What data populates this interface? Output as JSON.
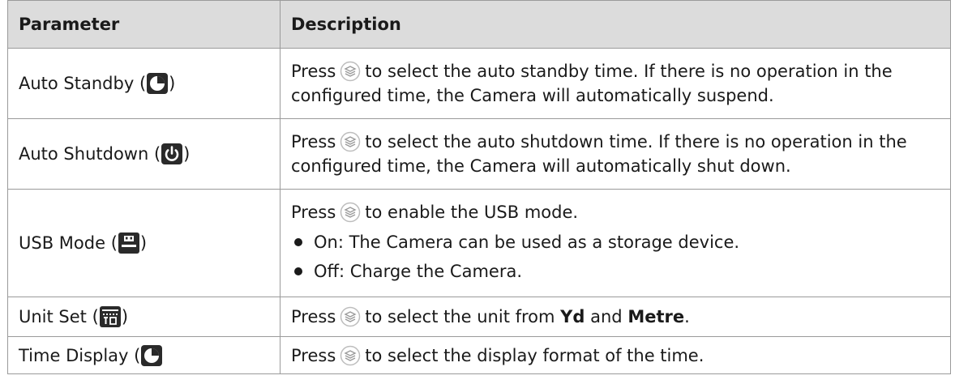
{
  "table": {
    "headers": {
      "parameter": "Parameter",
      "description": "Description"
    },
    "rows": [
      {
        "name": "Auto Standby",
        "icon": "standby-clock-icon",
        "desc_pre": "Press",
        "desc_post": "to select the auto standby time. If there is no operation in the configured time, the Camera will automatically suspend."
      },
      {
        "name": "Auto Shutdown",
        "icon": "power-icon",
        "desc_pre": "Press",
        "desc_post": "to select the auto shutdown time. If there is no operation in the configured time, the Camera will automatically shut down."
      },
      {
        "name": "USB Mode",
        "icon": "usb-storage-icon",
        "desc_pre": "Press",
        "desc_post": "to enable the USB mode.",
        "bullets": [
          "On: The Camera can be used as a storage device.",
          "Off: Charge the Camera."
        ]
      },
      {
        "name": "Unit Set",
        "icon": "unit-set-icon",
        "desc_pre": "Press",
        "desc_mid": "to select the unit from",
        "unit1": "Yd",
        "and": "and",
        "unit2": "Metre",
        "end": "."
      },
      {
        "name": "Time Display",
        "icon": "time-display-icon",
        "desc_pre": "Press",
        "desc_post": "to select the display format of the time."
      }
    ],
    "open_paren": "(",
    "close_paren": ")",
    "press_button_icon": "layers-button-icon"
  }
}
